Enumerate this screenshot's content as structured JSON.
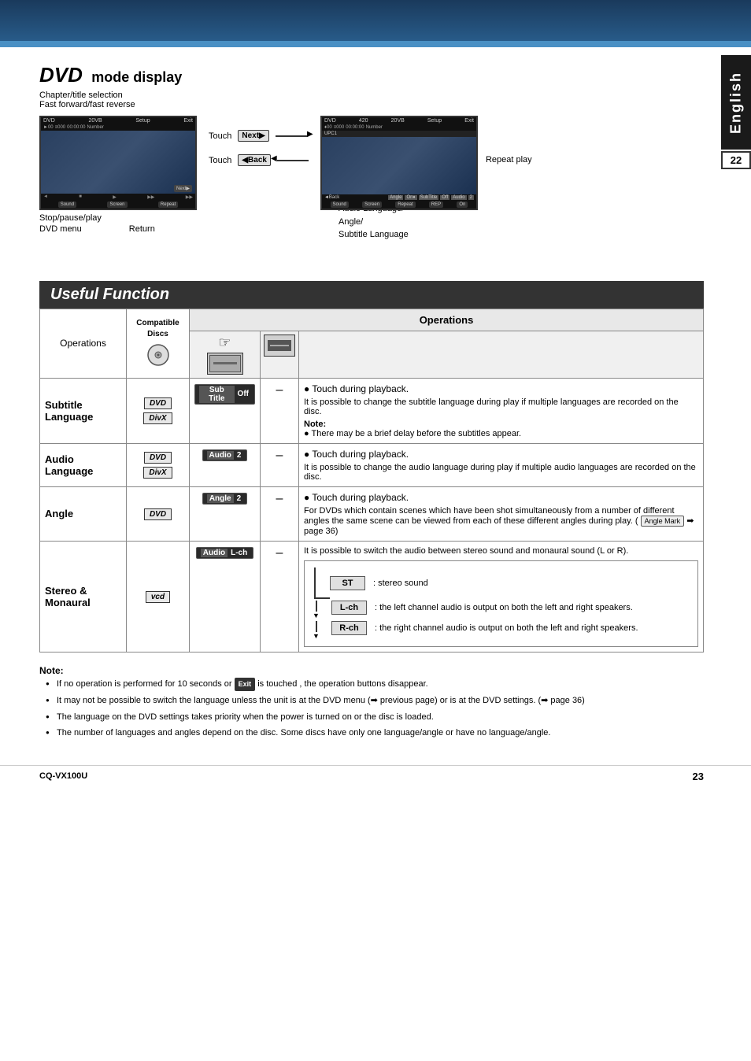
{
  "page": {
    "language_label": "English",
    "page_number_top": "22",
    "page_number_bottom": "23",
    "model_number": "CQ-VX100U"
  },
  "dvd_section": {
    "title": "DVD",
    "title_sub": "mode display",
    "label_chapter": "Chapter/title selection",
    "label_fastforward": "Fast forward/fast reverse",
    "touch_next_label": "Touch",
    "touch_next_btn": "Next▶",
    "touch_back_label": "Touch",
    "touch_back_btn": "◀Back",
    "repeat_play_label": "Repeat play",
    "stop_pause_play_label": "Stop/pause/play",
    "dvd_menu_label": "DVD menu",
    "return_label": "Return",
    "audio_lang_label": "Audio Language/\nAngle/\nSubtitle Language"
  },
  "useful_function": {
    "title": "Useful Function",
    "table": {
      "ops_header": "Operations",
      "compatible_discs_label": "Compatible\nDiscs",
      "operations_label": "Operations",
      "rows": [
        {
          "id": "subtitle-language",
          "label": "Subtitle Language",
          "discs": [
            "DVD",
            "DivX"
          ],
          "touch_display": "Sub Title  Off",
          "dash": "–",
          "bullet": "● Touch during playback.",
          "desc": "It is possible to change the subtitle language during play if multiple languages are recorded on the disc.",
          "note_label": "Note:",
          "note": "● There may be a brief delay before the subtitles appear."
        },
        {
          "id": "audio-language",
          "label": "Audio Language",
          "discs": [
            "DVD",
            "DivX"
          ],
          "touch_display": "Audio  2",
          "dash": "–",
          "bullet": "● Touch during playback.",
          "desc": "It is possible to change the audio language during play if multiple audio languages are recorded on the disc."
        },
        {
          "id": "angle",
          "label": "Angle",
          "discs": [
            "DVD"
          ],
          "touch_display": "Angle  2",
          "dash": "–",
          "bullet": "● Touch during playback.",
          "desc": "For DVDs which contain scenes which have been shot simultaneously from a number of different angles the same scene can be viewed from each of these different angles during play. ( Angle Mark ➡ page 36)"
        },
        {
          "id": "stereo-monaural",
          "label": "Stereo & Monaural",
          "discs": [
            "VCD"
          ],
          "touch_display": "Audio  L-ch",
          "dash": "–",
          "desc": "It is possible to switch the audio between stereo sound and monaural sound (L or R).",
          "stereo_items": [
            {
              "tag": "ST",
              "desc": ": stereo sound"
            },
            {
              "tag": "L-ch",
              "desc": ": the left channel audio is output on both the left and right speakers."
            },
            {
              "tag": "R-ch",
              "desc": ": the right channel audio is output on both the left and right speakers."
            }
          ]
        }
      ]
    }
  },
  "notes_bottom": {
    "title": "Note:",
    "items": [
      "If no operation is performed for 10 seconds or  Exit  is touched , the operation buttons disappear.",
      "It may not be possible to switch the language unless the unit is at the DVD menu (➡ previous page) or is at the DVD settings. (➡ page 36)",
      "The language on the DVD settings takes priority when the power is turned on or the disc is loaded.",
      "The number of languages and angles depend on the disc. Some discs have only one language/angle or have no language/angle."
    ]
  }
}
